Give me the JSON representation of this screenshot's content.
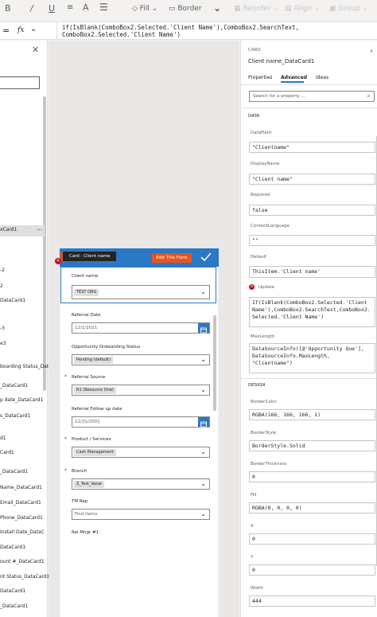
{
  "toolbar": {
    "fill_label": "Fill",
    "border_label": "Border",
    "reorder_label": "Reorder",
    "align_label": "Align",
    "group_label": "Group"
  },
  "formula_bar": {
    "fx_label": "fx",
    "formula_line1": "if(IsBlank(ComboBox2.Selected.'Client Name'),ComboBox2.SearchText,",
    "formula_line2": "ComboBox2.Selected.'Client Name')"
  },
  "tree_view": {
    "items": [
      "xCard1",
      "-2",
      "2",
      "DataCard1",
      "-3",
      "e3",
      "boarding Status_Dat",
      "_DataCard1",
      "p date_DataCard1",
      "s_DataCard1",
      "d1",
      "Card1",
      "_DataCard1",
      "Name_DataCard1",
      "Email_DataCard1",
      "Phone_DataCard1",
      "Install Date_DataC",
      "DataCard1",
      "ount #_DataCard1",
      "nt Status_DataCard1",
      "DataCard1",
      "_DataCard1"
    ],
    "more_label": "..."
  },
  "canvas": {
    "tooltip": "Card : Client name",
    "edit_button": "Edit This Form",
    "fields": [
      {
        "label": "Client name",
        "required": false,
        "control": "combo",
        "value": "TEST ORG"
      },
      {
        "label": "Referral Date",
        "required": false,
        "control": "date",
        "value": "12/1/2021"
      },
      {
        "label": "Opportunity Onboarding Status",
        "required": false,
        "control": "combo",
        "value": "Pending (default)"
      },
      {
        "label": "Referral Source",
        "required": true,
        "control": "combo",
        "value": "R1 (Resource One)"
      },
      {
        "label": "Referral Follow up date",
        "required": false,
        "control": "date",
        "value": "12/31/2001"
      },
      {
        "label": "Product / Services",
        "required": true,
        "control": "combo",
        "value": "Cash Management"
      },
      {
        "label": "Branch",
        "required": true,
        "control": "combo",
        "value": "Z_Test_Value"
      },
      {
        "label": "TM Rep",
        "required": false,
        "control": "combo-placeholder",
        "value": "Find items"
      },
      {
        "label": "Rel Mngr #1",
        "required": false,
        "control": "none",
        "value": ""
      }
    ]
  },
  "properties": {
    "kind": "CARD",
    "title": "Client name_DataCard1",
    "tabs": [
      "Properties",
      "Advanced",
      "Ideas"
    ],
    "active_tab": "Advanced",
    "search_placeholder": "Search for a property ...",
    "data_section": "DATA",
    "design_section": "DESIGN",
    "items": [
      {
        "label": "DataField",
        "value": "\"Clientname\""
      },
      {
        "label": "DisplayName",
        "value": "\"Client name\""
      },
      {
        "label": "Required",
        "value": "false"
      },
      {
        "label": "ContentLanguage",
        "value": "\"\""
      },
      {
        "label": "Default",
        "value": "ThisItem.'Client name'"
      },
      {
        "label": "Update",
        "value": "If(IsBlank(ComboBox2.Selected.'Client\nName'),ComboBox2.SearchText,ComboBox2.\nSelected.'Client Name')",
        "error": true
      },
      {
        "label": "MaxLength",
        "value": "DataSourceInfo([@'Opportunity Que'],\nDataSourceInfo.MaxLength,\n\"Clientname\")"
      }
    ],
    "design_items": [
      {
        "label": "BorderColor",
        "value": "RGBA(166, 166, 166, 1)"
      },
      {
        "label": "BorderStyle",
        "value": "BorderStyle.Solid"
      },
      {
        "label": "BorderThickness",
        "value": "0"
      },
      {
        "label": "Fill",
        "value": "RGBA(0, 0, 0, 0)"
      },
      {
        "label": "X",
        "value": "0"
      },
      {
        "label": "Y",
        "value": "0"
      },
      {
        "label": "Width",
        "value": "444"
      }
    ]
  },
  "colors": {
    "accent": "#2b78c5",
    "edit_button": "#e9531e",
    "error": "#c50f1f"
  }
}
